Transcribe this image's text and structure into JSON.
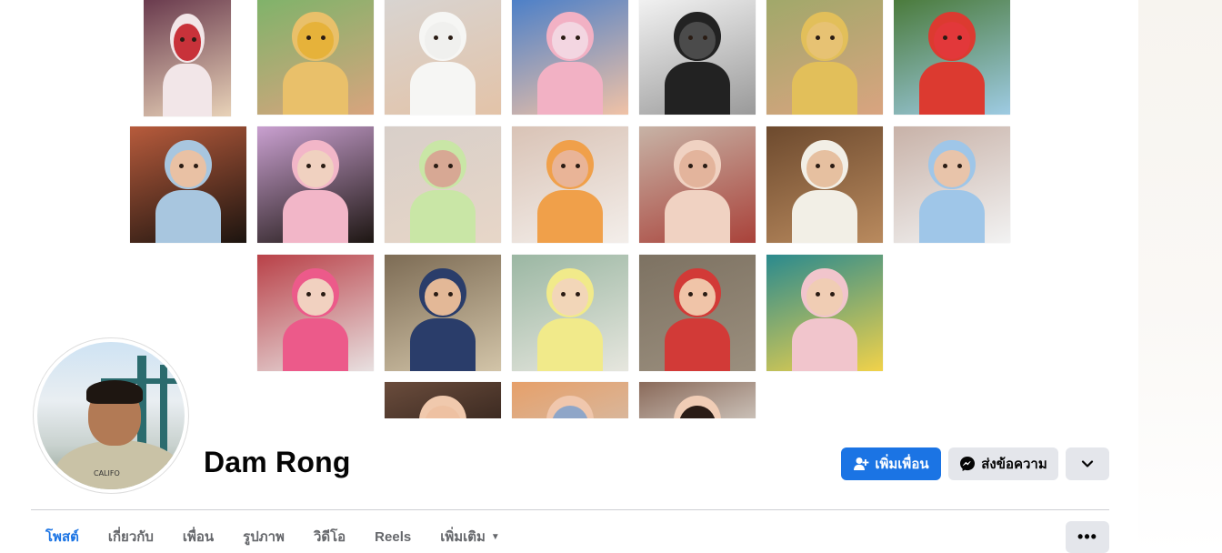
{
  "profile": {
    "name": "Dam Rong",
    "avatar_shirt_text": "CALIFO"
  },
  "cover": {
    "photos": [
      {
        "id": "baby-bunny-hat",
        "colors": [
          "#6a3b4e",
          "#f2e6e8",
          "#c8323a",
          "#e8d2b8"
        ]
      },
      {
        "id": "girl-yellow-dress",
        "colors": [
          "#7fb36a",
          "#e9c06a",
          "#e6b23a",
          "#d8a47e"
        ]
      },
      {
        "id": "newborn-white-wrap",
        "colors": [
          "#d8d4d1",
          "#f6f6f4",
          "#f0f0ee",
          "#e3c3a8"
        ]
      },
      {
        "id": "newborn-knit-hat",
        "colors": [
          "#4b7fc8",
          "#f2b1c4",
          "#f3d6e1",
          "#f0c2a6"
        ]
      },
      {
        "id": "ultrasound",
        "colors": [
          "#f2f2f2",
          "#222222",
          "#4b4b4b",
          "#9a9a9a"
        ]
      },
      {
        "id": "toddler-grass",
        "colors": [
          "#a0a86a",
          "#e2bf5a",
          "#e7c273",
          "#d9a480"
        ]
      },
      {
        "id": "girl-mask-red",
        "colors": [
          "#4a7a3a",
          "#dc3a30",
          "#e2383a",
          "#9ecbe3"
        ]
      },
      {
        "id": "girl-bangs",
        "colors": [
          "#b75b3c",
          "#a8c6df",
          "#e9c1a4",
          "#1c140f"
        ]
      },
      {
        "id": "baby-floral-bib",
        "colors": [
          "#c9a0d0",
          "#f2b6c8",
          "#f0d1c0",
          "#1d1612"
        ]
      },
      {
        "id": "newborn-green-hat",
        "colors": [
          "#d8cfc9",
          "#c9e6a6",
          "#d7a894",
          "#e7d6c8"
        ]
      },
      {
        "id": "newborn-orange-hat",
        "colors": [
          "#d9c3b6",
          "#f0a04a",
          "#e9b497",
          "#f3eeea"
        ]
      },
      {
        "id": "twin-babies",
        "colors": [
          "#c7b3a6",
          "#f0d2c2",
          "#e3b49c",
          "#a9423a"
        ]
      },
      {
        "id": "baby-sitting-tile",
        "colors": [
          "#6d4a2e",
          "#f2efe6",
          "#e6c0a0",
          "#b98a5e"
        ]
      },
      {
        "id": "girl-sitting-blue",
        "colors": [
          "#c8b2a8",
          "#9fc6e8",
          "#e8c4aa",
          "#f2f2f2"
        ]
      },
      {
        "id": "baby-pink-hat",
        "colors": [
          "#b94148",
          "#ec5a8a",
          "#f1d1c0",
          "#e8e0e0"
        ]
      },
      {
        "id": "toddler-boardwalk",
        "colors": [
          "#7d6c55",
          "#2a3d6a",
          "#e3b897",
          "#d2c4a8"
        ]
      },
      {
        "id": "toddler-yellow-hat",
        "colors": [
          "#9bb7a3",
          "#f1ea8a",
          "#f2d6b8",
          "#e6e6de"
        ]
      },
      {
        "id": "baby-red-bowl",
        "colors": [
          "#7d7262",
          "#d23a37",
          "#f0c4a8",
          "#9b8f7e"
        ]
      },
      {
        "id": "girl-pink-hood",
        "colors": [
          "#2a8a8e",
          "#f1c5cc",
          "#f0cdb4",
          "#f1d24a"
        ]
      },
      {
        "id": "baby-face-partial-1",
        "colors": [
          "#6a4c3c",
          "#f0c9ad",
          "#eec1a2",
          "#3d2b22"
        ]
      },
      {
        "id": "baby-face-partial-2",
        "colors": [
          "#e6a06a",
          "#f0c7ad",
          "#8fa6c8",
          "#d9b69a"
        ]
      },
      {
        "id": "girl-face-partial",
        "colors": [
          "#8a6a5a",
          "#f0cdb6",
          "#2a1c16",
          "#c9bfb6"
        ]
      }
    ]
  },
  "actions": {
    "add_friend_label": "เพิ่มเพื่อน",
    "message_label": "ส่งข้อความ",
    "more_icon": "chevron-down-icon"
  },
  "tabs": {
    "items": [
      {
        "label": "โพสต์",
        "active": true
      },
      {
        "label": "เกี่ยวกับ",
        "active": false
      },
      {
        "label": "เพื่อน",
        "active": false
      },
      {
        "label": "รูปภาพ",
        "active": false
      },
      {
        "label": "วิดีโอ",
        "active": false
      },
      {
        "label": "Reels",
        "active": false
      },
      {
        "label": "เพิ่มเติม",
        "active": false,
        "dropdown": true
      }
    ],
    "more_icon": "ellipsis-icon"
  },
  "colors": {
    "accent": "#1b74e4",
    "button_secondary": "#e4e6eb",
    "text_primary": "#050505",
    "text_secondary": "#65676b",
    "divider": "#ced0d4"
  }
}
